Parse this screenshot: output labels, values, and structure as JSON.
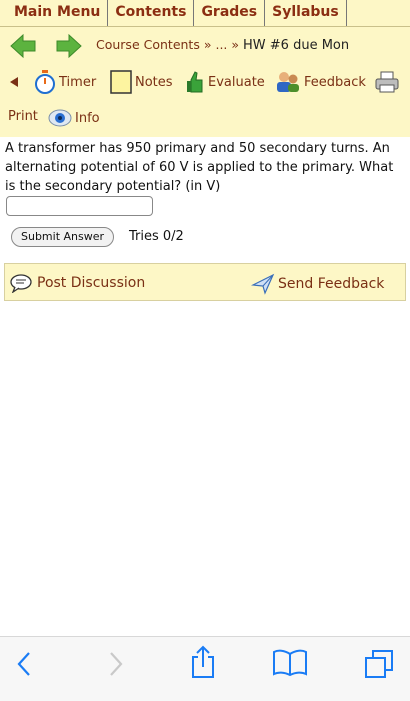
{
  "menu": [
    "Main Menu",
    "Contents",
    "Grades",
    "Syllabus"
  ],
  "breadcrumb": {
    "course": "Course Contents",
    "sep1": "»",
    "ellipsis": "...",
    "sep2": "»",
    "current": "HW #6 due Mon"
  },
  "tools": {
    "timer": "Timer",
    "notes": "Notes",
    "evaluate": "Evaluate",
    "feedback": "Feedback",
    "print": "Print",
    "info": "Info"
  },
  "problem": {
    "text": "A transformer has 950 primary and 50 secondary turns. An alternating potential of 60 V is applied to the primary. What is the secondary potential? (in V)",
    "answer_value": "",
    "submit_label": "Submit Answer",
    "tries": "Tries 0/2"
  },
  "discussion": {
    "post": "Post Discussion",
    "send": "Send Feedback"
  },
  "icons": {
    "back": "back-arrow-icon",
    "forward": "forward-arrow-icon",
    "share": "share-icon",
    "bookmarks": "book-icon",
    "tabs": "tabs-icon"
  },
  "colors": {
    "accent_bg": "#fdf7c6",
    "link": "#7a3015",
    "green_arrow": "#5cb33f",
    "ios_blue": "#1a7cf5"
  }
}
